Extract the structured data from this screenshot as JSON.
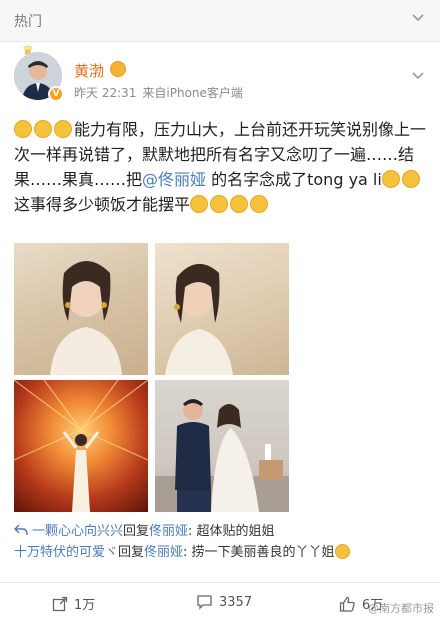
{
  "topbar": {
    "label": "热门"
  },
  "post": {
    "author": "黄渤",
    "time": "昨天 22:31",
    "source": "来自iPhone客户端",
    "text_1": "能力有限，压力山大，上台前还开玩笑说别像上一次一样再说错了，默默地把所有名字又念叨了一遍……结果……果真……把",
    "mention": "@佟丽娅",
    "text_2": " 的名字念成了tong ya li",
    "text_3": "这事得多少顿饭才能摆平"
  },
  "replies": [
    {
      "nick": "一颗心心向兴兴",
      "mid": "回复",
      "target": "佟丽娅",
      "text": ": 超体贴的姐姐"
    },
    {
      "nick": "十万特伏的可爱ヾ",
      "mid": "回复",
      "target": "佟丽娅",
      "text": ": 捞一下美丽善良的丫丫姐"
    }
  ],
  "actions": {
    "repost": "1万",
    "comments": "3357",
    "likes": "6万"
  },
  "watermark": "@南方都市报",
  "colors": {
    "accent": "#ea6f1d",
    "link": "#4b7cb9",
    "badge": "#f7a31a"
  }
}
